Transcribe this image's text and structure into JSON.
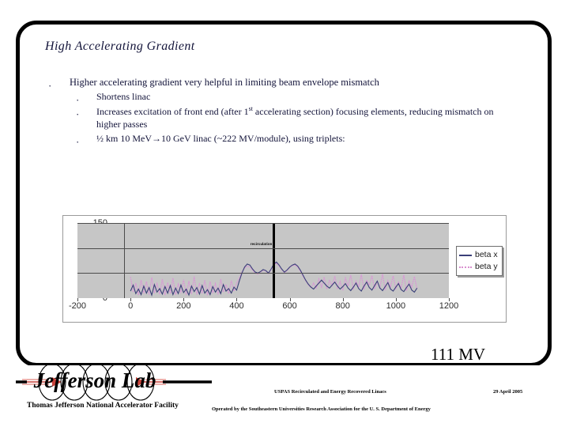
{
  "slide": {
    "title": "High Accelerating Gradient",
    "bullets": [
      {
        "level": 1,
        "marker": "·",
        "text": "Higher accelerating gradient very helpful in limiting beam envelope mismatch"
      },
      {
        "level": 2,
        "marker": "·",
        "text": "Shortens linac"
      },
      {
        "level": 2,
        "marker": "·",
        "text_before": "Increases excitation of front end (after 1",
        "superscript": "st",
        "text_after": " accelerating section) focusing elements, reducing mismatch on higher passes"
      },
      {
        "level": 2,
        "marker": "·",
        "text": "½ km 10 MeV→10 GeV linac (~222 MV/module), using triplets:"
      }
    ],
    "callout": "111 MV"
  },
  "chart_data": {
    "type": "line",
    "title": "",
    "xlabel": "",
    "ylabel": "",
    "xlim": [
      -200,
      1200
    ],
    "ylim": [
      0,
      150
    ],
    "xticks": [
      -200,
      0,
      200,
      400,
      600,
      800,
      1000,
      1200
    ],
    "yticks": [
      0,
      50,
      100,
      150
    ],
    "grid": true,
    "plot_bgcolor": "#c6c6c6",
    "legend_position": "right",
    "annotations": [
      {
        "name": "recirculation-marker",
        "label": "recirculation",
        "x": 540,
        "style": "vertical-black-line"
      }
    ],
    "series": [
      {
        "name": "beta x",
        "color": "#3a3f78",
        "style": "solid",
        "x": [
          0,
          10,
          20,
          30,
          40,
          50,
          60,
          70,
          80,
          90,
          100,
          110,
          120,
          130,
          140,
          150,
          160,
          170,
          180,
          190,
          200,
          210,
          220,
          230,
          240,
          250,
          260,
          270,
          280,
          290,
          300,
          310,
          320,
          330,
          340,
          350,
          360,
          370,
          380,
          390,
          400,
          410,
          420,
          430,
          440,
          450,
          460,
          470,
          480,
          490,
          500,
          510,
          520,
          530,
          540,
          550,
          560,
          570,
          580,
          590,
          600,
          610,
          620,
          630,
          640,
          650,
          660,
          670,
          680,
          690,
          700,
          710,
          720,
          730,
          740,
          750,
          760,
          770,
          780,
          790,
          800,
          810,
          820,
          830,
          840,
          850,
          860,
          870,
          880,
          890,
          900,
          910,
          920,
          930,
          940,
          950,
          960,
          970,
          980,
          990,
          1000,
          1010,
          1020,
          1030,
          1040,
          1050,
          1060,
          1070,
          1080
        ],
        "y": [
          14,
          26,
          9,
          18,
          7,
          24,
          10,
          21,
          6,
          27,
          12,
          19,
          8,
          23,
          10,
          25,
          7,
          20,
          9,
          26,
          11,
          18,
          6,
          24,
          13,
          21,
          8,
          25,
          10,
          17,
          7,
          23,
          12,
          20,
          9,
          27,
          14,
          19,
          10,
          22,
          16,
          34,
          50,
          62,
          68,
          66,
          58,
          52,
          50,
          53,
          57,
          55,
          50,
          58,
          68,
          72,
          66,
          58,
          52,
          56,
          62,
          66,
          68,
          64,
          56,
          46,
          36,
          28,
          22,
          18,
          24,
          30,
          36,
          30,
          24,
          20,
          26,
          32,
          24,
          18,
          23,
          29,
          20,
          15,
          22,
          30,
          19,
          14,
          24,
          32,
          21,
          16,
          25,
          34,
          20,
          15,
          23,
          31,
          18,
          14,
          22,
          29,
          17,
          13,
          21,
          28,
          16,
          12,
          20,
          26,
          10
        ]
      },
      {
        "name": "beta y",
        "color": "#dc8fd8",
        "style": "dotted",
        "x": [
          0,
          10,
          20,
          30,
          40,
          50,
          60,
          70,
          80,
          90,
          100,
          110,
          120,
          130,
          140,
          150,
          160,
          170,
          180,
          190,
          200,
          210,
          220,
          230,
          240,
          250,
          260,
          270,
          280,
          290,
          300,
          310,
          320,
          330,
          340,
          350,
          360,
          370,
          380,
          390,
          400,
          410,
          420,
          430,
          440,
          450,
          460,
          470,
          480,
          490,
          500,
          510,
          520,
          530,
          540,
          550,
          560,
          570,
          580,
          590,
          600,
          610,
          620,
          630,
          640,
          650,
          660,
          670,
          680,
          690,
          700,
          710,
          720,
          730,
          740,
          750,
          760,
          770,
          780,
          790,
          800,
          810,
          820,
          830,
          840,
          850,
          860,
          870,
          880,
          890,
          900,
          910,
          920,
          930,
          940,
          950,
          960,
          970,
          980,
          990,
          1000,
          1010,
          1020,
          1030,
          1040,
          1050,
          1060,
          1070,
          1080
        ],
        "y": [
          42,
          12,
          30,
          6,
          36,
          9,
          33,
          7,
          41,
          10,
          29,
          8,
          38,
          6,
          31,
          9,
          40,
          7,
          28,
          10,
          37,
          6,
          34,
          8,
          43,
          7,
          30,
          9,
          36,
          6,
          33,
          10,
          29,
          7,
          38,
          12,
          27,
          9,
          35,
          14,
          30,
          40,
          52,
          60,
          64,
          62,
          56,
          50,
          48,
          52,
          56,
          54,
          49,
          57,
          66,
          70,
          64,
          57,
          51,
          55,
          61,
          65,
          66,
          62,
          54,
          44,
          35,
          27,
          21,
          30,
          20,
          38,
          22,
          42,
          18,
          35,
          25,
          44,
          20,
          33,
          15,
          40,
          24,
          46,
          19,
          34,
          22,
          47,
          17,
          36,
          26,
          45,
          18,
          33,
          21,
          48,
          16,
          35,
          23,
          44,
          19,
          32,
          20,
          46,
          15,
          34,
          22,
          43,
          18,
          40,
          8
        ]
      }
    ],
    "legend_entries": [
      {
        "label": "beta x",
        "color": "#3a3f78",
        "style": "solid"
      },
      {
        "label": "beta y",
        "color": "#d98fd0",
        "style": "dotted"
      }
    ]
  },
  "footer": {
    "logo_text": "Jefferson Lab",
    "logo_caption": "Thomas Jefferson National Accelerator Facility",
    "middle": "USPAS Recirculated and Energy Recovered Linacs",
    "date": "29 April 2005",
    "bottom": "Operated by the Southeastern Universities Research Association for the U. S. Department of Energy"
  }
}
